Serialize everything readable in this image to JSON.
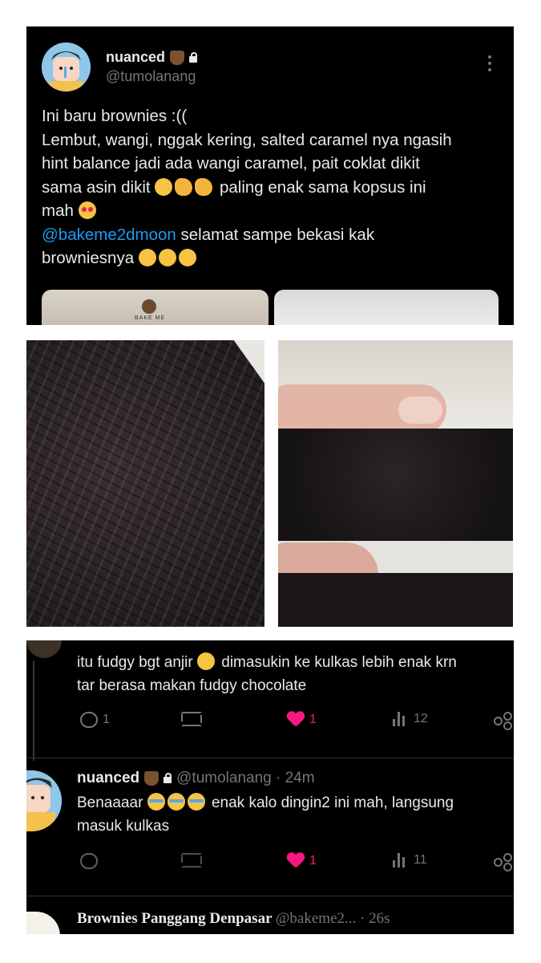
{
  "top_tweet": {
    "display_name": "nuanced",
    "handle": "@tumolanang",
    "text_lines": [
      "Ini baru brownies :((",
      "Lembut, wangi, nggak kering, salted caramel nya ngasih",
      "hint balance jadi ada wangi caramel, pait coklat dikit",
      "sama asin dikit",
      "paling enak sama kopsus ini",
      "mah"
    ],
    "mention": "@bakeme2dmoon",
    "mention_suffix": "selamat sampe bekasi kak",
    "last_line": "browniesnya",
    "media_peek_text": "BAKE ME"
  },
  "replies": [
    {
      "text_lines": [
        "itu fudgy bgt anjir",
        "dimasukin ke kulkas lebih enak krn",
        "tar berasa makan fudgy chocolate"
      ],
      "reply_count": "1",
      "like_count": "1",
      "view_count": "12"
    },
    {
      "display_name": "nuanced",
      "handle_time": "@tumolanang · 24m",
      "text_lines": [
        "Benaaaar",
        "enak kalo dingin2 ini mah, langsung",
        "masuk kulkas"
      ],
      "like_count": "1",
      "view_count": "11"
    },
    {
      "display_name": "Brownies Panggang Denpasar",
      "handle_time": "@bakeme2... · 26s"
    }
  ],
  "colors": {
    "background": "#000000",
    "text": "#e7e9ea",
    "muted": "#71767b",
    "link": "#1d9bf0",
    "like": "#f91880"
  }
}
